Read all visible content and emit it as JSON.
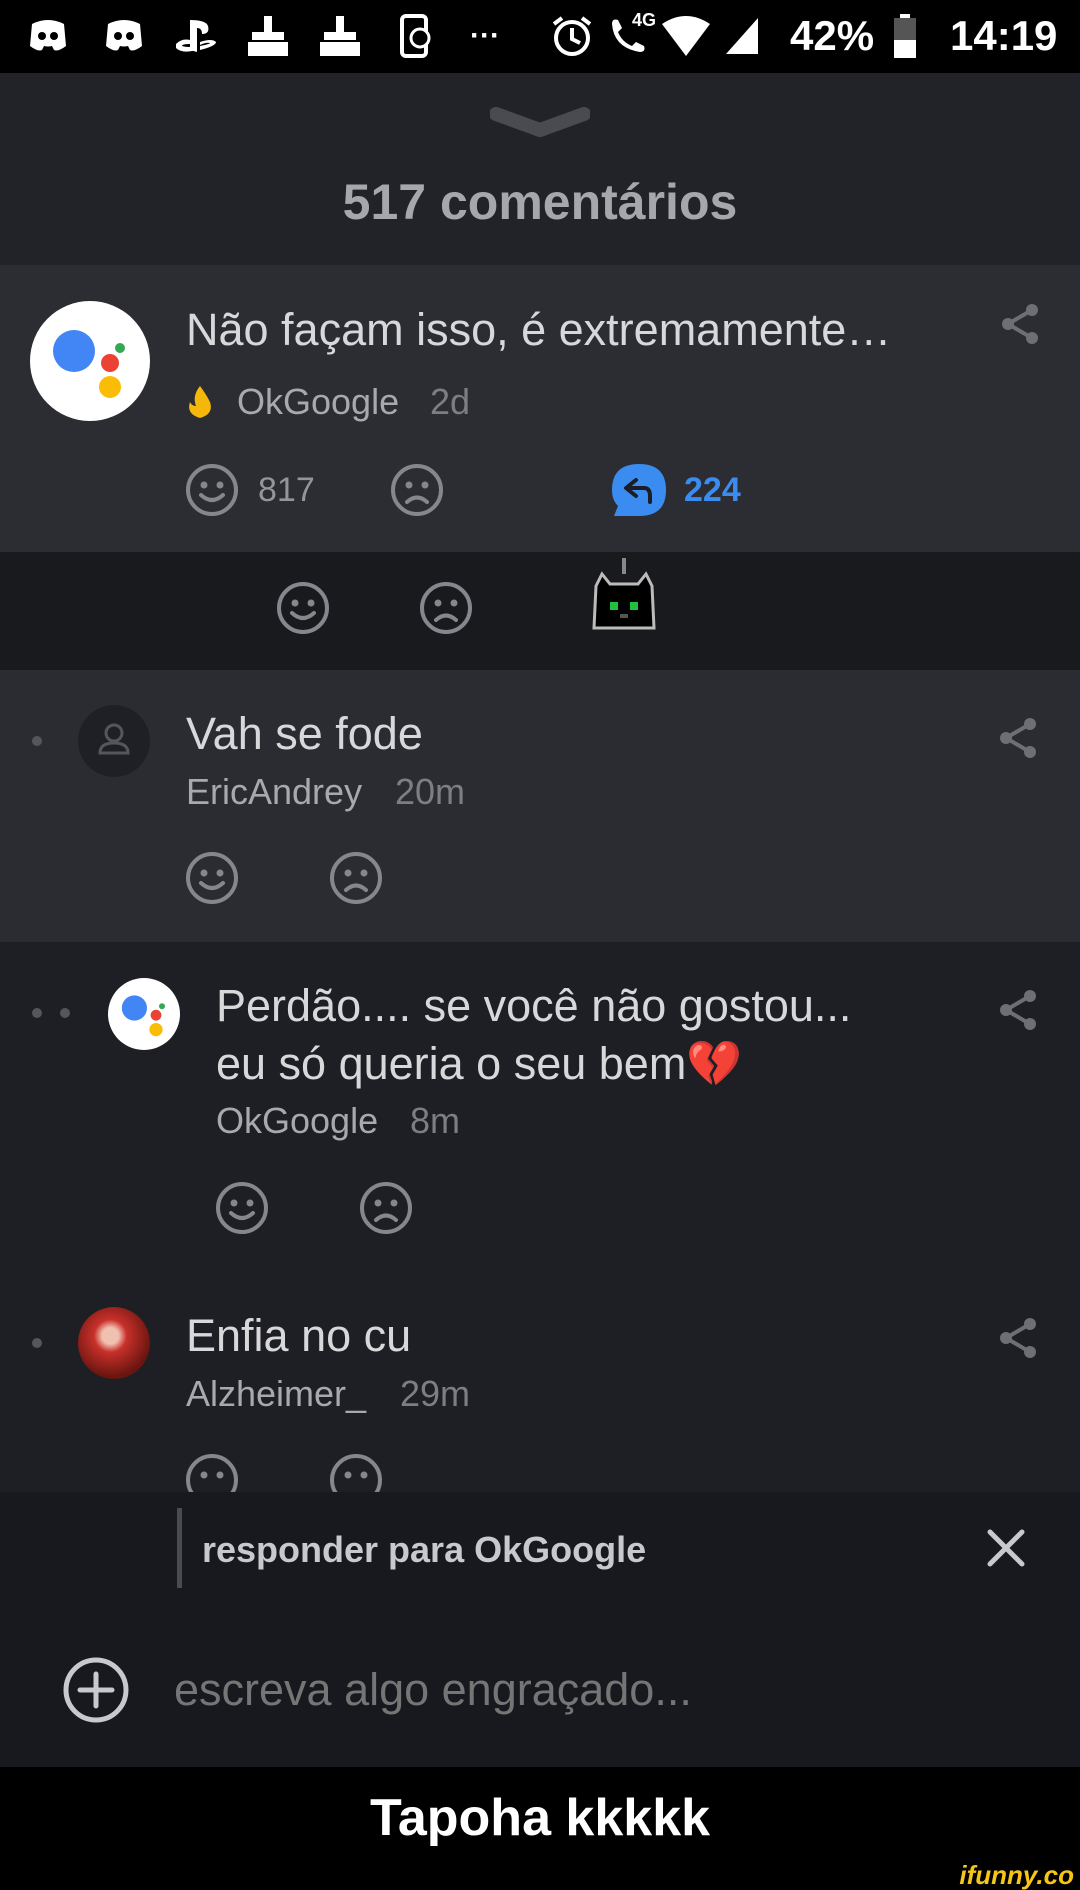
{
  "status_bar": {
    "battery": "42%",
    "time": "14:19",
    "network": "4G",
    "more": "···"
  },
  "header": {
    "title": "517 comentários"
  },
  "comments": [
    {
      "text": "Não façam isso, é extremamente…",
      "user": "OkGoogle",
      "time": "2d",
      "likes": "817",
      "replies": "224"
    },
    {
      "text": "Vah se fode",
      "user": "EricAndrey",
      "time": "20m"
    },
    {
      "text_line1": "Perdão.... se você não gostou...",
      "text_line2": "eu só queria o seu bem",
      "emoji": "💔",
      "user": "OkGoogle",
      "time": "8m"
    },
    {
      "text": "Enfia no cu",
      "user": "Alzheimer_",
      "time": "29m"
    }
  ],
  "reply_bar": {
    "label": "responder para OkGoogle",
    "placeholder": "escreva algo engraçado..."
  },
  "caption": "Tapoha kkkkk",
  "watermark": "ifunny.co",
  "colors": {
    "accent_blue": "#3b8cf0",
    "background": "#1d1e23",
    "fire": "#f5b70a"
  }
}
